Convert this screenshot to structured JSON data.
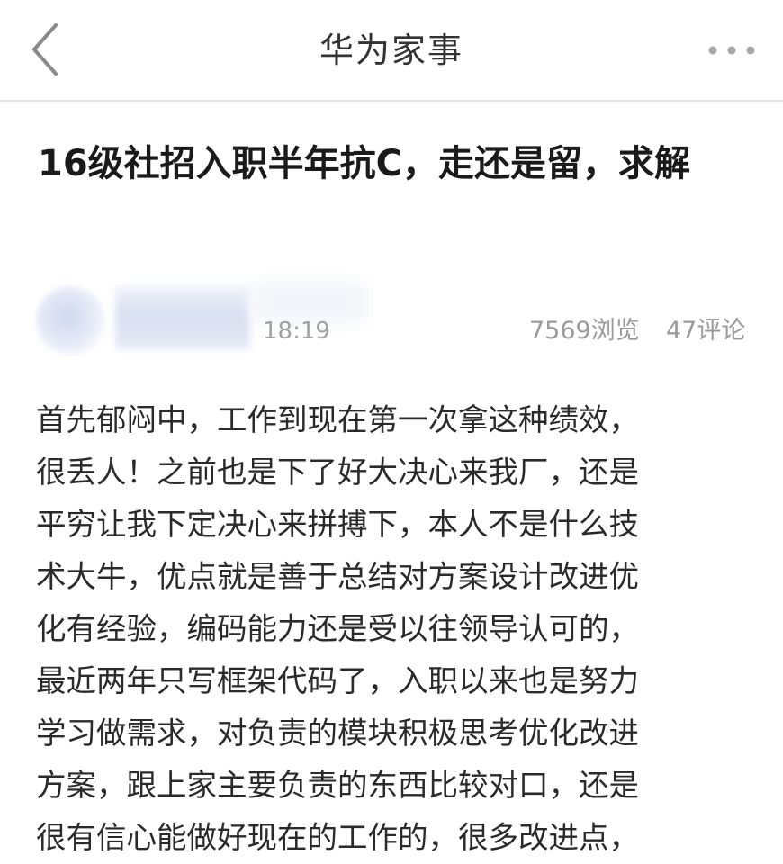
{
  "nav": {
    "title": "华为家事",
    "back_icon": "chevron-left-icon",
    "more_icon": "ellipsis-icon"
  },
  "post": {
    "title": "16级社招入职半年抗C，走还是留，求解",
    "time": "18:19",
    "views": "7569浏览",
    "comments": "47评论",
    "body_lines": [
      "首先郁闷中，工作到现在第一次拿这种绩效，",
      "很丢人！之前也是下了好大决心来我厂，还是",
      "平穷让我下定决心来拼搏下，本人不是什么技",
      "术大牛，优点就是善于总结对方案设计改进优",
      "化有经验，编码能力还是受以往领导认可的，",
      "最近两年只写框架代码了，入职以来也是努力",
      "学习做需求，对负责的模块积极思考优化改进",
      "方案，跟上家主要负责的东西比较对口，还是",
      "很有信心能做好现在的工作的，很多改进点，"
    ]
  },
  "colors": {
    "background": "#ffffff",
    "title_text": "#1a1a1a",
    "meta_text": "#9a9a9a",
    "divider": "#e6e6e6"
  }
}
